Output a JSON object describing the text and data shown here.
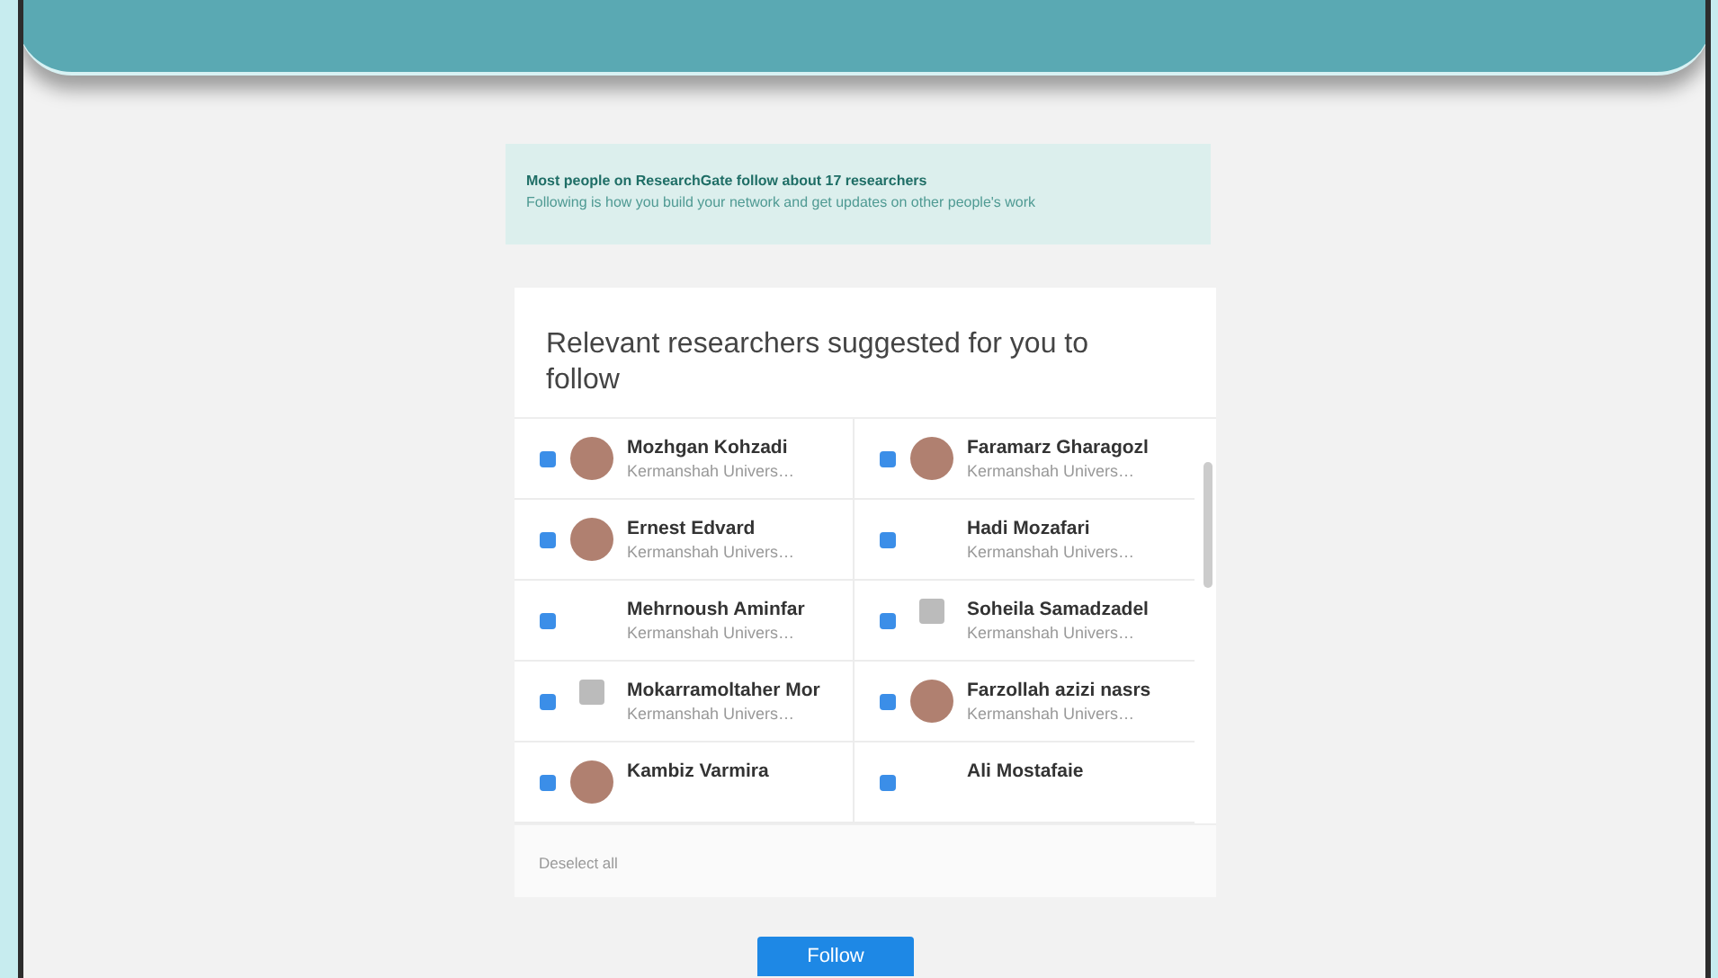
{
  "notice": {
    "title": "Most people on ResearchGate follow about 17 researchers",
    "text": "Following is how you build your network and get updates on other people's work"
  },
  "suggestions": {
    "title": "Relevant researchers suggested for you to follow",
    "researchers": [
      {
        "name": "Mozhgan Kohzadi",
        "affiliation": "Kermanshah Univers…",
        "checked": true,
        "kind": "photo"
      },
      {
        "name": "Faramarz Gharagozl",
        "affiliation": "Kermanshah Univers…",
        "checked": true,
        "kind": "photo"
      },
      {
        "name": "Ernest Edvard",
        "affiliation": "Kermanshah Univers…",
        "checked": true,
        "kind": "photo"
      },
      {
        "name": "Hadi Mozafari",
        "affiliation": "Kermanshah Univers…",
        "checked": true,
        "kind": "blank"
      },
      {
        "name": "Mehrnoush Aminfar",
        "affiliation": "Kermanshah Univers…",
        "checked": true,
        "kind": "blank"
      },
      {
        "name": "Soheila Samadzadel",
        "affiliation": "Kermanshah Univers…",
        "checked": true,
        "kind": "icon"
      },
      {
        "name": "Mokarramoltaher Mor",
        "affiliation": "Kermanshah Univers…",
        "checked": true,
        "kind": "icon"
      },
      {
        "name": "Farzollah azizi nasrs",
        "affiliation": "Kermanshah Univers…",
        "checked": true,
        "kind": "photo"
      },
      {
        "name": "Kambiz Varmira",
        "checked": true,
        "kind": "photo"
      },
      {
        "name": "Ali Mostafaie",
        "checked": true,
        "kind": "blank"
      }
    ],
    "deselect_link": "Deselect all"
  },
  "follow_button": "Follow"
}
